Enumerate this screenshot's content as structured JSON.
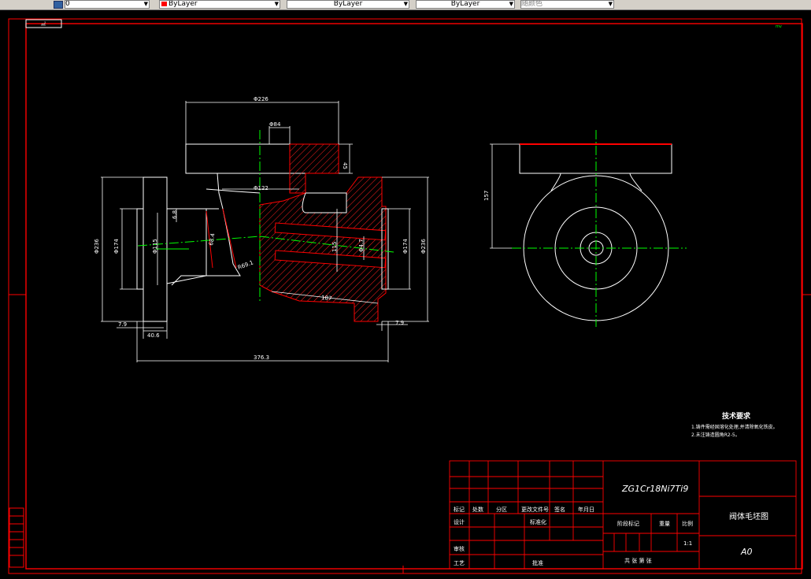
{
  "toolbar": {
    "layer_value": "0",
    "color_value": "ByLayer",
    "linetype_value": "ByLayer",
    "lineweight_value": "ByLayer",
    "plotstyle_value": "随颜色"
  },
  "viewport": {
    "label": "㎡",
    "marker": "mv"
  },
  "dimensions": {
    "top_dia": "Φ226",
    "bore_top": "Φ84",
    "flange_thk": "45",
    "inner_dia": "Φ122",
    "left_od": "Φ236",
    "left_mid": "Φ174",
    "left_bore": "Φ115",
    "wall": "6.8",
    "angle_left": "68.4",
    "radius": "R69.1",
    "right_bore": "115",
    "right_small": "Φ4.7",
    "right_mid": "Φ174",
    "right_od": "Φ236",
    "slant_len": "187",
    "left_thk": "7.9",
    "left_hub": "40.6",
    "right_thk": "7.9",
    "overall": "376.3",
    "side_height": "157"
  },
  "tech_req": {
    "title": "技术要求",
    "line1": "1.铸件需经固溶化处理,并清除氧化铁皮。",
    "line2": "2.未注铸造圆角R2-5。"
  },
  "title_block": {
    "material": "ZG1Cr18Ni7Ti9",
    "part_name": "阀体毛坯图",
    "scale": "1:1",
    "sheet_size": "A0",
    "h_mark": "标记",
    "h_count": "处数",
    "h_zone": "分区",
    "h_docno": "更改文件号",
    "h_sign": "签名",
    "h_date": "年月日",
    "design": "设计",
    "standardize": "标准化",
    "stage_mark": "阶段标记",
    "weight": "重量",
    "scale_label": "比例",
    "review": "审核",
    "process": "工艺",
    "approve": "批准",
    "sheets": "共 张 第 张"
  }
}
